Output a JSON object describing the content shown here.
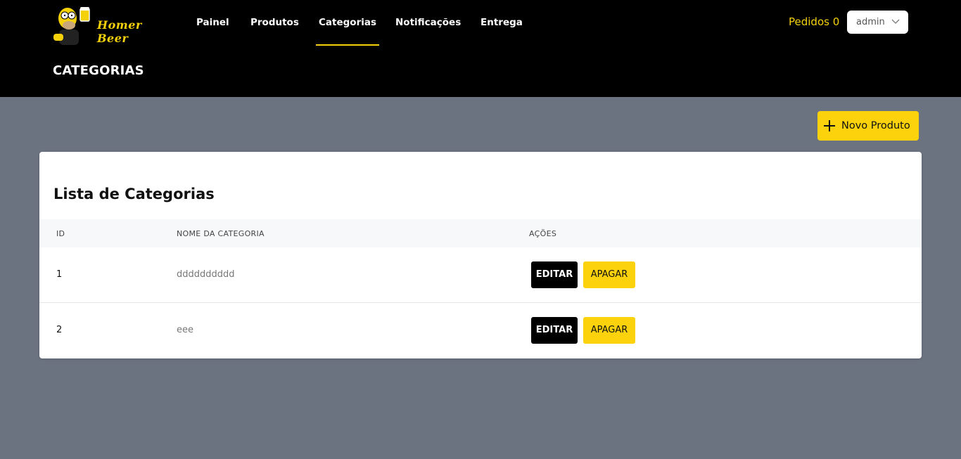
{
  "brand": {
    "logo_text": "Homer Beer"
  },
  "nav": {
    "items": [
      {
        "label": "Painel"
      },
      {
        "label": "Produtos"
      },
      {
        "label": "Categorias"
      },
      {
        "label": "Notificações"
      },
      {
        "label": "Entrega"
      }
    ],
    "active": "Categorias"
  },
  "header": {
    "orders_label": "Pedidos 0",
    "user_select": {
      "selected": "admin",
      "icon": "chevron-down-icon"
    },
    "page_title": "CATEGORIAS"
  },
  "toolbar": {
    "new_button_label": "Novo Produto",
    "new_button_icon": "plus-icon"
  },
  "card": {
    "title": "Lista de Categorias",
    "columns": [
      "ID",
      "NOME DA CATEGORIA",
      "AÇÕES"
    ],
    "rows": [
      {
        "id": "1",
        "name": "dddddddddd",
        "edit_label": "EDITAR",
        "delete_label": "APAGAR"
      },
      {
        "id": "2",
        "name": "eee",
        "edit_label": "EDITAR",
        "delete_label": "APAGAR"
      }
    ]
  },
  "colors": {
    "accent": "#fcd20d",
    "header_bg": "#000000",
    "page_bg": "#6b7280",
    "card_bg": "#ffffff"
  }
}
